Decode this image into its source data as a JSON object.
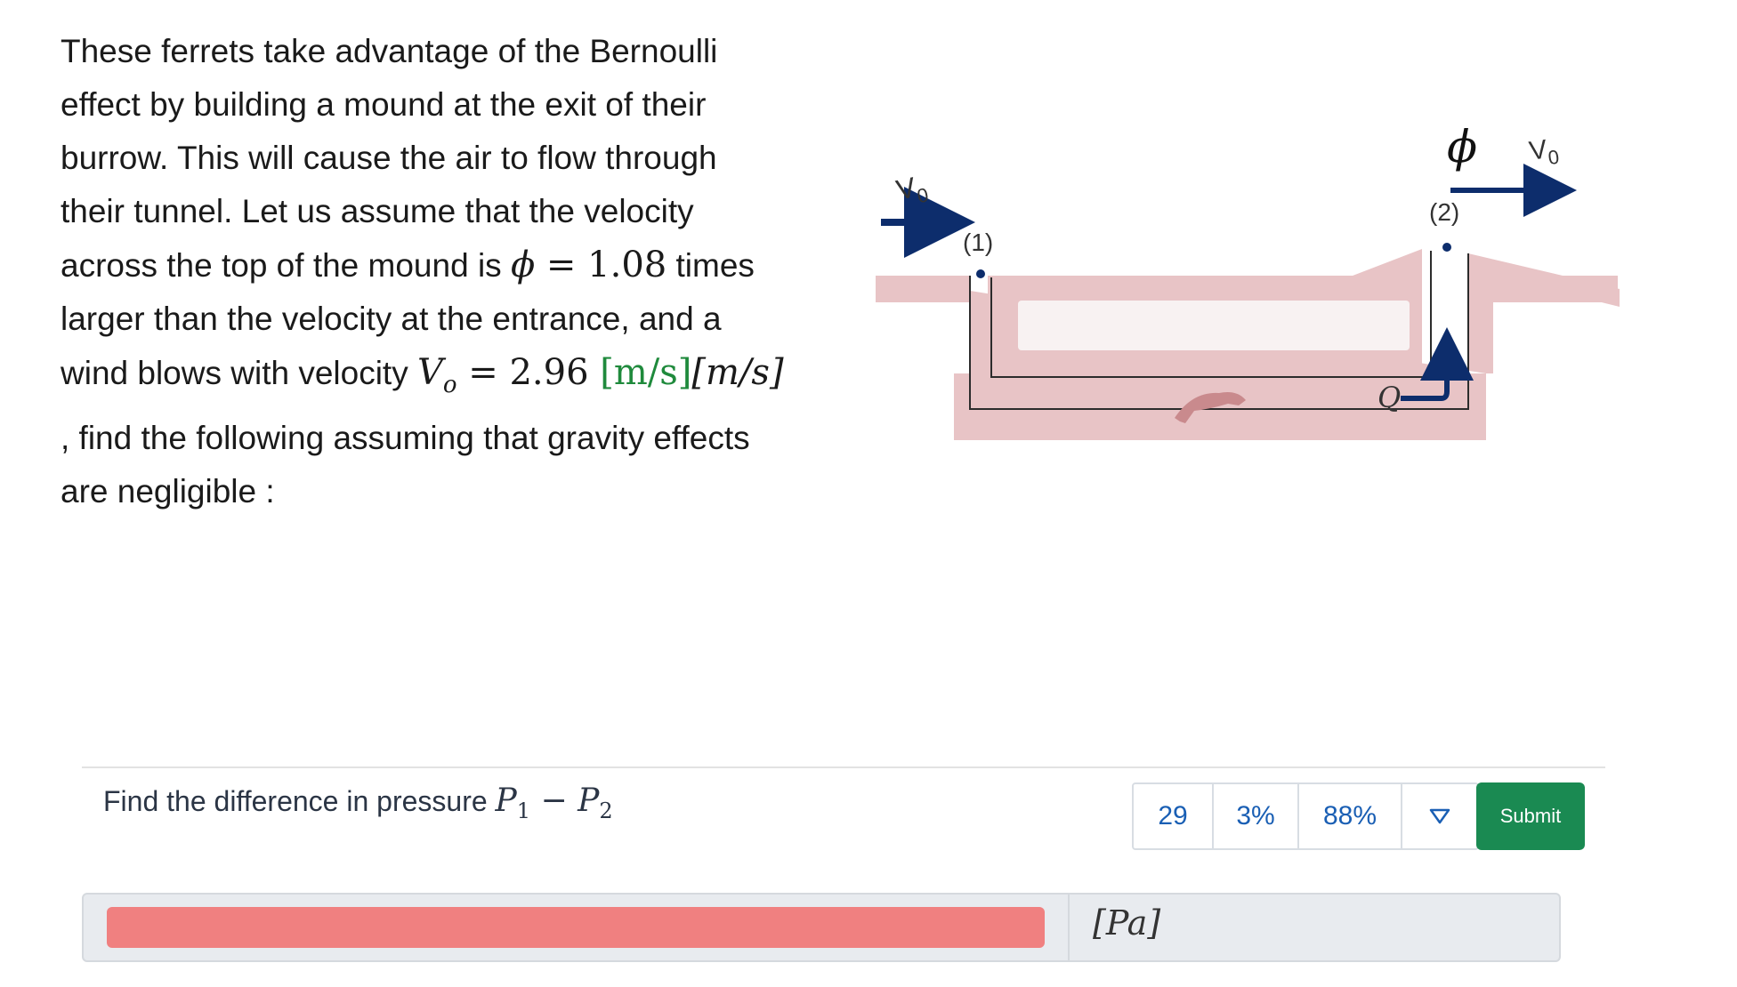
{
  "problem": {
    "line1": "These ferrets take advantage of the Bernoulli",
    "line2": "effect by building a mound at the exit of their",
    "line3": "burrow. This will cause the air to flow through",
    "line4": "their tunnel. Let us assume that the velocity",
    "line5_pre": "across the top of the mound is ",
    "phi_symbol": "ϕ",
    "equals": " = ",
    "phi_value": "1.08",
    "line5_post": " times",
    "line6": "larger than the velocity at the entrance, and a",
    "line7_pre": "wind blows with velocity ",
    "vo_symbol": "V",
    "vo_sub": "o",
    "vo_value": "2.96",
    "vo_unit_green": "[m/s]",
    "vo_unit_italic": "[m/s]",
    "line8": ", find the following assuming that gravity effects",
    "line9": "are negligible :"
  },
  "diagram": {
    "vo_left_label": "V",
    "vo_left_sub": "0",
    "point1_label": "(1)",
    "point2_label": "(2)",
    "phi_label": "ϕ",
    "vo_right_label": "V",
    "vo_right_sub": "0",
    "q_label": "Q"
  },
  "question": {
    "prefix": "Find the difference in pressure ",
    "p1": "P",
    "p1_sub": "1",
    "minus": " − ",
    "p2": "P",
    "p2_sub": "2"
  },
  "stats": {
    "attempts": "29",
    "percent_a": "3%",
    "percent_b": "88%"
  },
  "submit_label": "Submit",
  "answer": {
    "value": "",
    "unit": "[Pa]"
  },
  "colors": {
    "accent_green": "#1a8a52",
    "stat_blue": "#1a5fb4",
    "answer_error": "#f08080",
    "tunnel_pink": "#e8c4c6",
    "arrow_navy": "#0d2d6c"
  }
}
